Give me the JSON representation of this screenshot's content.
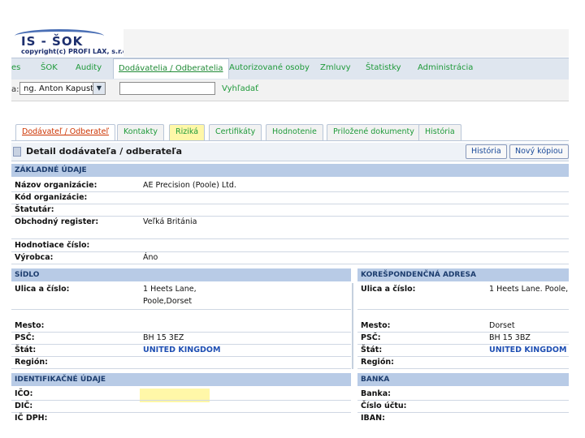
{
  "logo": {
    "title": "IS - ŠOK",
    "subtitle": "copyright(c) PROFI LAX, s.r.o."
  },
  "menu": {
    "items": [
      "ŠOK",
      "Audity",
      "Dodávatelia / Odberatelia",
      "Autorizované osoby",
      "Zmluvy",
      "Štatistky",
      "Administrácia"
    ],
    "active_index": 2,
    "left_stub": "es"
  },
  "search": {
    "left_stub": "a:",
    "selected_user": "ng. Anton Kapusta",
    "button": "Vyhľadať",
    "input_value": ""
  },
  "tabs": {
    "items": [
      "Dodávateľ / Odberateľ",
      "Kontakty",
      "Riziká",
      "Certifikáty",
      "Hodnotenie",
      "Priložené dokumenty",
      "História"
    ],
    "active_index": 0,
    "highlighted_index": 2
  },
  "detail": {
    "title": "Detail dodávateľa / odberateľa",
    "btn_history": "História",
    "btn_new_copy": "Nový kópiou"
  },
  "sections": {
    "basic": "ZÁKLADNÉ ÚDAJE",
    "seat": "SÍDLO",
    "correspondence": "KOREŠPONDENČNÁ ADRESA",
    "identification": "IDENTIFIKAČNÉ ÚDAJE",
    "bank": "BANKA"
  },
  "basic": {
    "org_name_label": "Názov organizácie:",
    "org_name": "AE Precision (Poole) Ltd.",
    "org_code_label": "Kód organizácie:",
    "org_code": "",
    "statutory_label": "Štatutár:",
    "statutory": "",
    "register_label": "Obchodný register:",
    "register": "Veľká Británia",
    "rating_label": "Hodnotiace číslo:",
    "rating": "",
    "producer_label": "Výrobca:",
    "producer": "Áno"
  },
  "seat": {
    "street_label": "Ulica a číslo:",
    "street_1": "1 Heets Lane,",
    "street_2": "Poole,Dorset",
    "city_label": "Mesto:",
    "city": "",
    "zip_label": "PSČ:",
    "zip": "BH 15 3EZ",
    "state_label": "Štát:",
    "state": "UNITED KINGDOM",
    "region_label": "Región:",
    "region": ""
  },
  "corr": {
    "street_label": "Ulica a číslo:",
    "street": "1 Heets Lane. Poole,",
    "city_label": "Mesto:",
    "city": "Dorset",
    "zip_label": "PSČ:",
    "zip": "BH 15 3BZ",
    "state_label": "Štát:",
    "state": "UNITED KINGDOM",
    "region_label": "Región:",
    "region": ""
  },
  "ident": {
    "ico_label": "IČO:",
    "dic_label": "DIČ:",
    "icdph_label": "IČ DPH:"
  },
  "bank": {
    "bank_label": "Banka:",
    "account_label": "Číslo účtu:",
    "iban_label": "IBAN:"
  },
  "colors": {
    "menu_link": "#1f9a3a",
    "section_header": "#b8cbe6",
    "active_tab": "#cc3300",
    "highlight": "#fff7a8"
  }
}
